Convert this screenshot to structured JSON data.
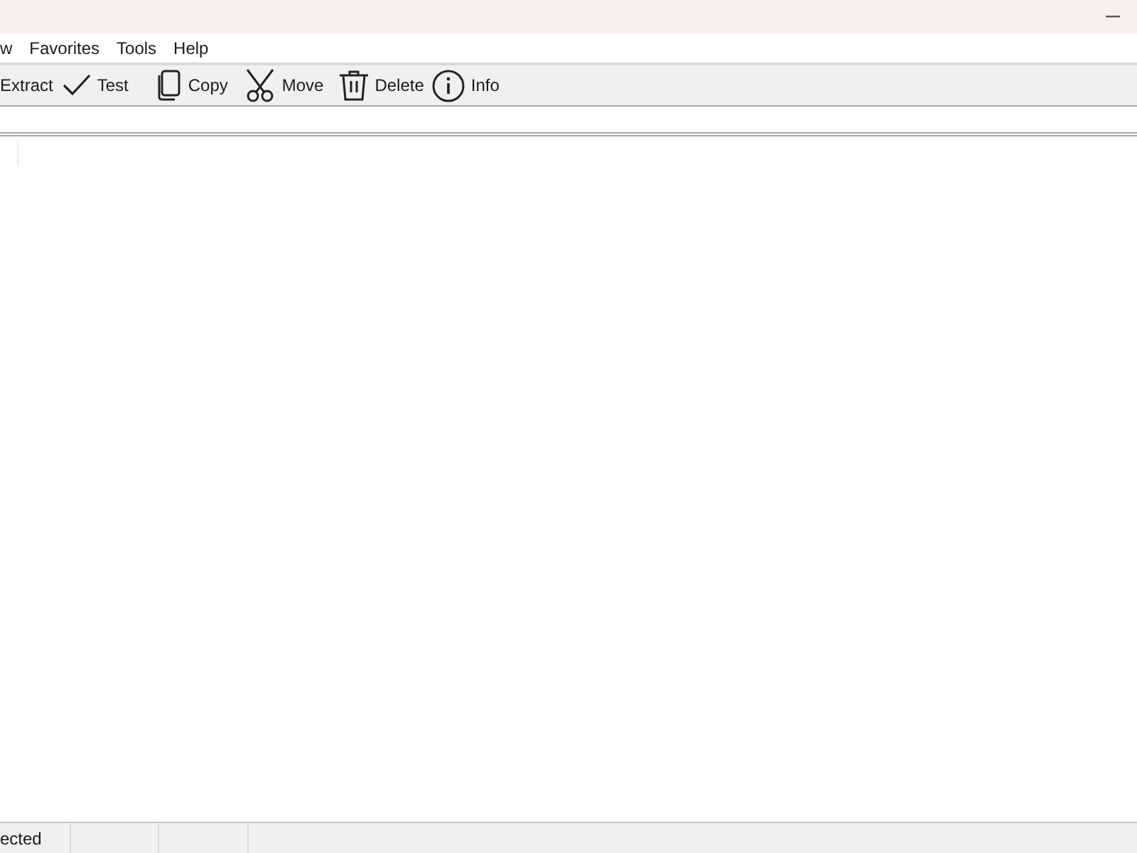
{
  "menu": [
    {
      "label": "w"
    },
    {
      "label": "Favorites"
    },
    {
      "label": "Tools"
    },
    {
      "label": "Help"
    }
  ],
  "toolbar": [
    {
      "label": "Extract",
      "kind": "text"
    },
    {
      "label": "Test",
      "kind": "check"
    },
    {
      "label": "Copy",
      "kind": "copy"
    },
    {
      "label": "Move",
      "kind": "scissors"
    },
    {
      "label": "Delete",
      "kind": "trash"
    },
    {
      "label": "Info",
      "kind": "info"
    }
  ],
  "status_bar": [
    "ected"
  ]
}
